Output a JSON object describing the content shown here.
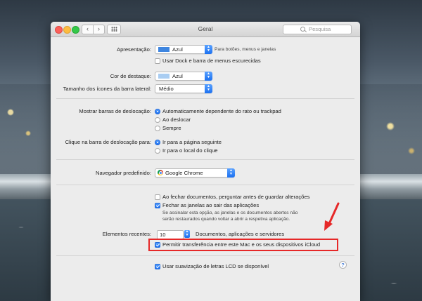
{
  "window": {
    "title": "Geral",
    "search_placeholder": "Pesquisa",
    "back_glyph": "‹",
    "forward_glyph": "›"
  },
  "appearance": {
    "label": "Apresentação:",
    "value": "Azul",
    "swatch_color": "#3f86e0",
    "note": "Para botões, menus e janelas",
    "dark_menu_label": "Usar Dock e barra de menus escurecidas",
    "dark_menu_checked": false
  },
  "highlight": {
    "label": "Cor de destaque:",
    "value": "Azul",
    "swatch_color": "#a9cdf2"
  },
  "sidebar_icons": {
    "label": "Tamanho dos ícones da barra lateral:",
    "value": "Médio"
  },
  "scrollbars": {
    "label": "Mostrar barras de deslocação:",
    "options": [
      "Automaticamente dependente do rato ou trackpad",
      "Ao deslocar",
      "Sempre"
    ],
    "selected": 0
  },
  "scroll_click": {
    "label": "Clique na barra de deslocação para:",
    "options": [
      "Ir para a página seguinte",
      "Ir para o local do clique"
    ],
    "selected": 0
  },
  "browser": {
    "label": "Navegador predefinido:",
    "value": "Google Chrome"
  },
  "documents": {
    "ask_save_label": "Ao fechar documentos, perguntar antes de guardar alterações",
    "ask_save_checked": false,
    "close_windows_label": "Fechar as janelas ao sair das aplicações",
    "close_windows_checked": true,
    "close_windows_note": [
      "Se assinalar esta opção, as janelas e os documentos abertos não",
      "serão restaurados quando voltar a abrir a respetiva aplicação."
    ]
  },
  "recent": {
    "label": "Elementos recentes:",
    "value": "10",
    "suffix": "Documentos, aplicações e servidores"
  },
  "handoff": {
    "label": "Permitir transferência entre este Mac e os seus dispositivos iCloud",
    "checked": true
  },
  "lcd": {
    "label": "Usar suavização de letras LCD se disponível",
    "checked": true
  },
  "help": {
    "glyph": "?"
  },
  "colors": {
    "accent": "#1c70f0",
    "annotation_red": "#e62828"
  }
}
